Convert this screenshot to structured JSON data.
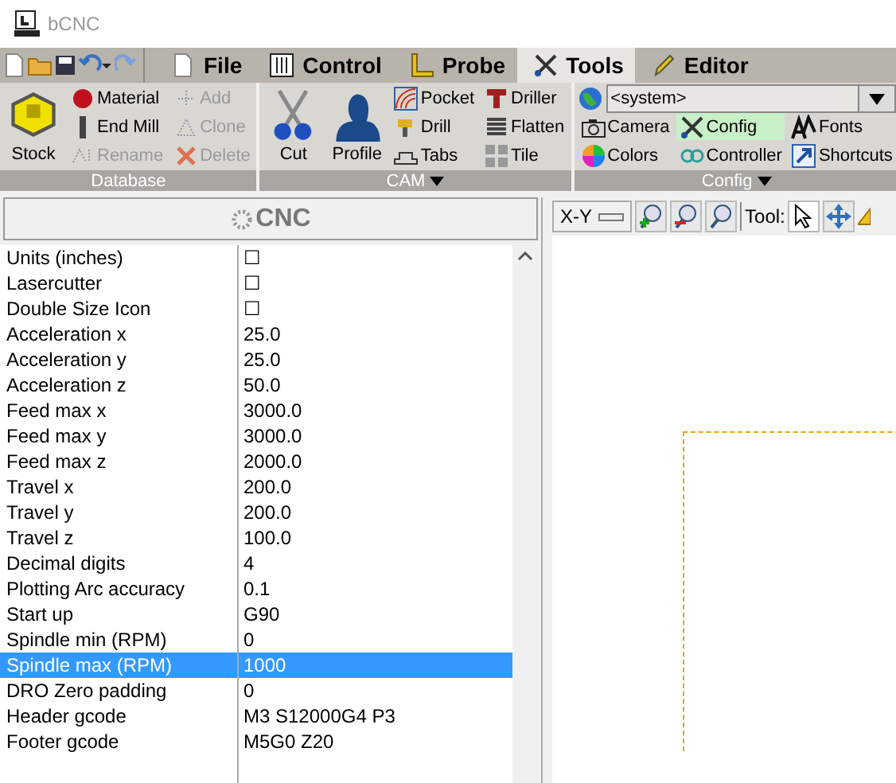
{
  "window": {
    "title": "bCNC"
  },
  "tabs": [
    {
      "label": "File",
      "selected": false
    },
    {
      "label": "Control",
      "selected": false
    },
    {
      "label": "Probe",
      "selected": false
    },
    {
      "label": "Tools",
      "selected": true
    },
    {
      "label": "Editor",
      "selected": false
    }
  ],
  "ribbon": {
    "groups": [
      {
        "label": "Database",
        "has_menu": false,
        "columns": [
          [
            {
              "label": "Stock",
              "kind": "large",
              "disabled": false,
              "selected": false
            }
          ],
          [
            {
              "label": "Material",
              "kind": "small",
              "disabled": false,
              "selected": false
            },
            {
              "label": "End Mill",
              "kind": "small",
              "disabled": false,
              "selected": false
            },
            {
              "label": "Rename",
              "kind": "small",
              "disabled": true,
              "selected": false
            }
          ],
          [
            {
              "label": "Add",
              "kind": "small",
              "disabled": true,
              "selected": false
            },
            {
              "label": "Clone",
              "kind": "small",
              "disabled": true,
              "selected": false
            },
            {
              "label": "Delete",
              "kind": "small",
              "disabled": true,
              "selected": false
            }
          ]
        ]
      },
      {
        "label": "CAM",
        "has_menu": true,
        "columns": [
          [
            {
              "label": "Cut",
              "kind": "large",
              "disabled": false,
              "selected": false
            }
          ],
          [
            {
              "label": "Profile",
              "kind": "large",
              "disabled": false,
              "selected": false
            }
          ],
          [
            {
              "label": "Pocket",
              "kind": "small",
              "disabled": false,
              "selected": false
            },
            {
              "label": "Drill",
              "kind": "small",
              "disabled": false,
              "selected": false
            },
            {
              "label": "Tabs",
              "kind": "small",
              "disabled": false,
              "selected": false
            }
          ],
          [
            {
              "label": "Driller",
              "kind": "small",
              "disabled": false,
              "selected": false
            },
            {
              "label": "Flatten",
              "kind": "small",
              "disabled": false,
              "selected": false
            },
            {
              "label": "Tile",
              "kind": "small",
              "disabled": false,
              "selected": false
            }
          ]
        ]
      },
      {
        "label": "Config",
        "has_menu": true,
        "combo": "<system>",
        "columns": [
          [
            {
              "label": "Camera",
              "kind": "small",
              "disabled": false,
              "selected": false
            },
            {
              "label": "Colors",
              "kind": "small",
              "disabled": false,
              "selected": false
            }
          ],
          [
            {
              "label": "Config",
              "kind": "small",
              "disabled": false,
              "selected": true
            },
            {
              "label": "Controller",
              "kind": "small",
              "disabled": false,
              "selected": false
            }
          ],
          [
            {
              "label": "Fonts",
              "kind": "small",
              "disabled": false,
              "selected": false
            },
            {
              "label": "Shortcuts",
              "kind": "small",
              "disabled": false,
              "selected": false
            }
          ]
        ]
      }
    ]
  },
  "panel": {
    "title": "CNC",
    "rows": [
      {
        "name": "Units (inches)",
        "value": "☐",
        "selected": false
      },
      {
        "name": "Lasercutter",
        "value": "☐",
        "selected": false
      },
      {
        "name": "Double Size Icon",
        "value": "☐",
        "selected": false
      },
      {
        "name": "Acceleration x",
        "value": "25.0",
        "selected": false
      },
      {
        "name": "Acceleration y",
        "value": "25.0",
        "selected": false
      },
      {
        "name": "Acceleration z",
        "value": "50.0",
        "selected": false
      },
      {
        "name": "Feed max x",
        "value": "3000.0",
        "selected": false
      },
      {
        "name": "Feed max y",
        "value": "3000.0",
        "selected": false
      },
      {
        "name": "Feed max z",
        "value": "2000.0",
        "selected": false
      },
      {
        "name": "Travel x",
        "value": "200.0",
        "selected": false
      },
      {
        "name": "Travel y",
        "value": "200.0",
        "selected": false
      },
      {
        "name": "Travel z",
        "value": "100.0",
        "selected": false
      },
      {
        "name": "Decimal digits",
        "value": "4",
        "selected": false
      },
      {
        "name": "Plotting Arc accuracy",
        "value": "0.1",
        "selected": false
      },
      {
        "name": "Start up",
        "value": "G90",
        "selected": false
      },
      {
        "name": "Spindle min (RPM)",
        "value": "0",
        "selected": false
      },
      {
        "name": "Spindle max (RPM)",
        "value": "1000",
        "selected": true
      },
      {
        "name": "DRO Zero padding",
        "value": "0",
        "selected": false
      },
      {
        "name": "Header gcode",
        "value": "M3 S12000G4 P3",
        "selected": false
      },
      {
        "name": "Footer gcode",
        "value": "M5G0 Z20",
        "selected": false
      }
    ]
  },
  "canvas": {
    "view": "X-Y",
    "tool_label": "Tool:"
  }
}
